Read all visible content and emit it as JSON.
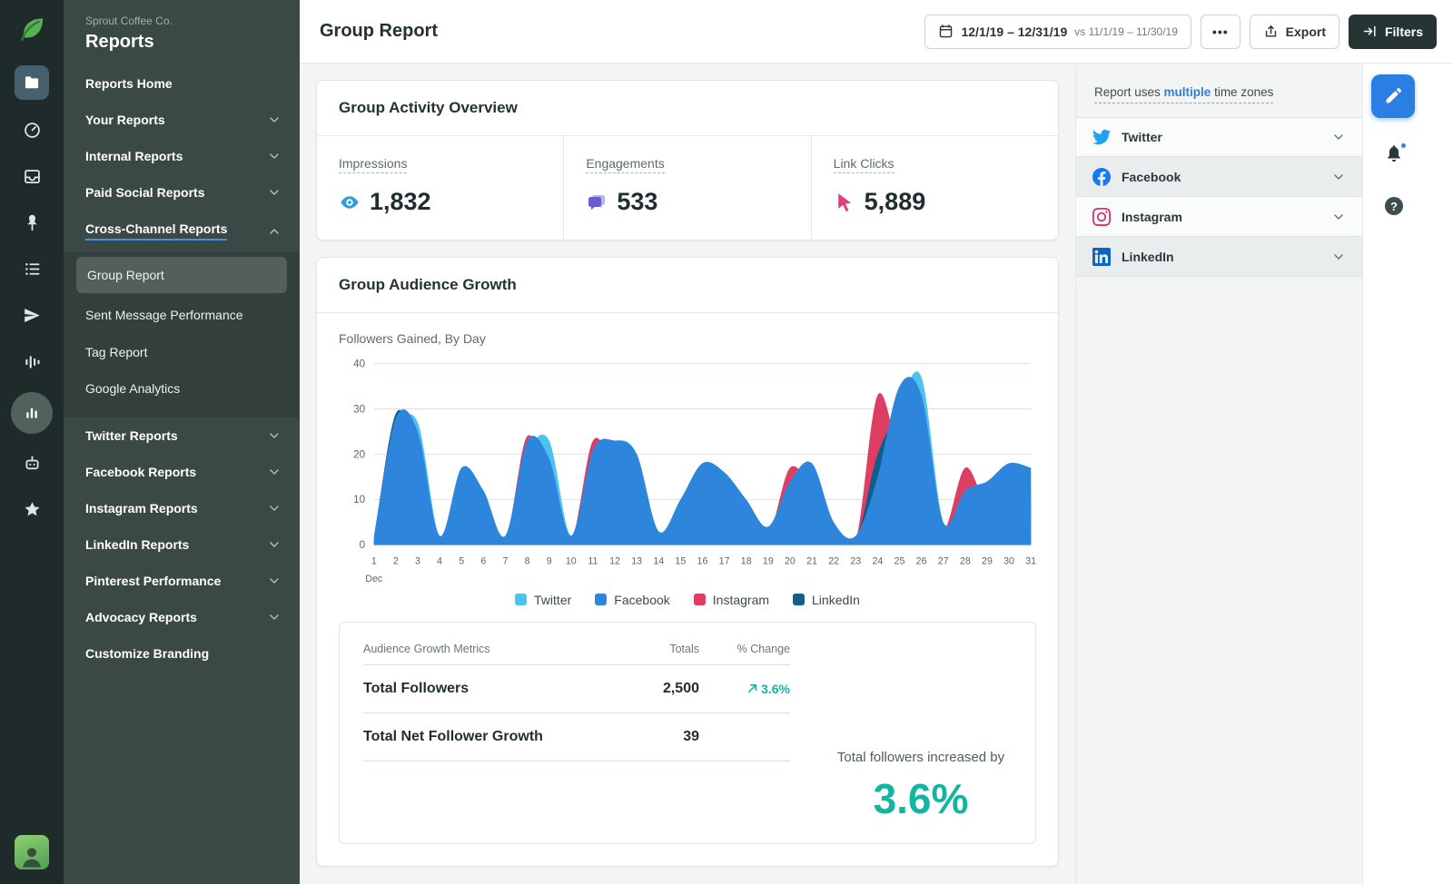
{
  "brand": {
    "company": "Sprout Coffee Co.",
    "section": "Reports"
  },
  "rail": {
    "icons": [
      "sprout-logo-icon",
      "folder-icon",
      "gauge-icon",
      "inbox-icon",
      "pin-icon",
      "list-icon",
      "paper-plane-icon",
      "equalizer-icon",
      "bar-chart-icon",
      "bot-icon",
      "star-icon",
      "user-avatar"
    ]
  },
  "sidebar": {
    "items": [
      {
        "label": "Reports Home"
      },
      {
        "label": "Your Reports"
      },
      {
        "label": "Internal Reports"
      },
      {
        "label": "Paid Social Reports"
      },
      {
        "label": "Cross-Channel Reports"
      }
    ],
    "sub_items": [
      {
        "label": "Group Report"
      },
      {
        "label": "Sent Message Performance"
      },
      {
        "label": "Tag Report"
      },
      {
        "label": "Google Analytics"
      }
    ],
    "items_lower": [
      {
        "label": "Twitter Reports"
      },
      {
        "label": "Facebook Reports"
      },
      {
        "label": "Instagram Reports"
      },
      {
        "label": "LinkedIn Reports"
      },
      {
        "label": "Pinterest Performance"
      },
      {
        "label": "Advocacy Reports"
      },
      {
        "label": "Customize Branding"
      }
    ]
  },
  "topbar": {
    "title": "Group Report",
    "date_range": "12/1/19 – 12/31/19",
    "compare_range": "vs 11/1/19 – 11/30/19",
    "more_label": "•••",
    "export_label": "Export",
    "filters_label": "Filters"
  },
  "activity": {
    "title": "Group Activity Overview",
    "metrics": [
      {
        "label": "Impressions",
        "value": "1,832",
        "icon": "eye-icon",
        "color": "#2F9FDC"
      },
      {
        "label": "Engagements",
        "value": "533",
        "icon": "chat-bubbles-icon",
        "color": "#6A5BD8"
      },
      {
        "label": "Link Clicks",
        "value": "5,889",
        "icon": "cursor-icon",
        "color": "#E0417C"
      }
    ]
  },
  "growth": {
    "title": "Group Audience Growth",
    "subtitle": "Followers Gained, By Day",
    "chart_data": {
      "type": "area",
      "title": "Followers Gained, By Day",
      "x_label_month": "Dec",
      "x": [
        1,
        2,
        3,
        4,
        5,
        6,
        7,
        8,
        9,
        10,
        11,
        12,
        13,
        14,
        15,
        16,
        17,
        18,
        19,
        20,
        21,
        22,
        23,
        24,
        25,
        26,
        27,
        28,
        29,
        30,
        31
      ],
      "ylim": [
        0,
        40
      ],
      "yticks": [
        0,
        10,
        20,
        30,
        40
      ],
      "grid": true,
      "legend_position": "bottom",
      "paint_order": [
        2,
        3,
        0,
        1
      ],
      "series": [
        {
          "name": "Twitter",
          "color": "#4CC2F1",
          "values": [
            1,
            24,
            27,
            2,
            14,
            10,
            2,
            20,
            23,
            2,
            19,
            23,
            20,
            2,
            8,
            16,
            15,
            9,
            3,
            12,
            16,
            4,
            1,
            12,
            30,
            37,
            5,
            10,
            13,
            17,
            16
          ]
        },
        {
          "name": "Facebook",
          "color": "#2D85DC",
          "values": [
            2,
            28,
            25,
            2,
            17,
            12,
            2,
            23,
            19,
            2,
            21,
            23,
            20,
            3,
            10,
            18,
            16,
            10,
            4,
            14,
            18,
            5,
            2,
            15,
            35,
            33,
            5,
            12,
            14,
            18,
            17
          ]
        },
        {
          "name": "Instagram",
          "color": "#DF3E63",
          "values": [
            1,
            25,
            15,
            1,
            10,
            7,
            1,
            24,
            12,
            1,
            23,
            17,
            12,
            1,
            6,
            12,
            11,
            6,
            2,
            17,
            12,
            3,
            1,
            33,
            20,
            12,
            3,
            17,
            9,
            11,
            10
          ]
        },
        {
          "name": "LinkedIn",
          "color": "#0F5E8E",
          "values": [
            1,
            29,
            20,
            1,
            12,
            8,
            1,
            19,
            14,
            1,
            18,
            19,
            14,
            1,
            7,
            13,
            12,
            7,
            2,
            11,
            14,
            3,
            1,
            20,
            28,
            25,
            3,
            9,
            10,
            13,
            12
          ]
        }
      ]
    },
    "table": {
      "headers": [
        "Audience Growth Metrics",
        "Totals",
        "% Change"
      ],
      "rows": [
        {
          "metric": "Total Followers",
          "total": "2,500",
          "change": "3.6%",
          "change_positive": true
        },
        {
          "metric": "Total Net Follower Growth",
          "total": "39",
          "change": ""
        }
      ]
    },
    "summary_text": "Total followers increased by",
    "summary_value": "3.6%"
  },
  "right_panel": {
    "timezone_prefix": "Report uses ",
    "timezone_link": "multiple",
    "timezone_suffix": " time zones",
    "networks": [
      {
        "label": "Twitter",
        "color": "#1DA1F2"
      },
      {
        "label": "Facebook",
        "color": "#1877F2"
      },
      {
        "label": "Instagram",
        "color": "#D6356F"
      },
      {
        "label": "LinkedIn",
        "color": "#0A66C2"
      }
    ]
  },
  "colors": {
    "positive_teal": "#12B5A2",
    "brand_green": "#56B254",
    "accent_blue": "#2B7FE3"
  }
}
